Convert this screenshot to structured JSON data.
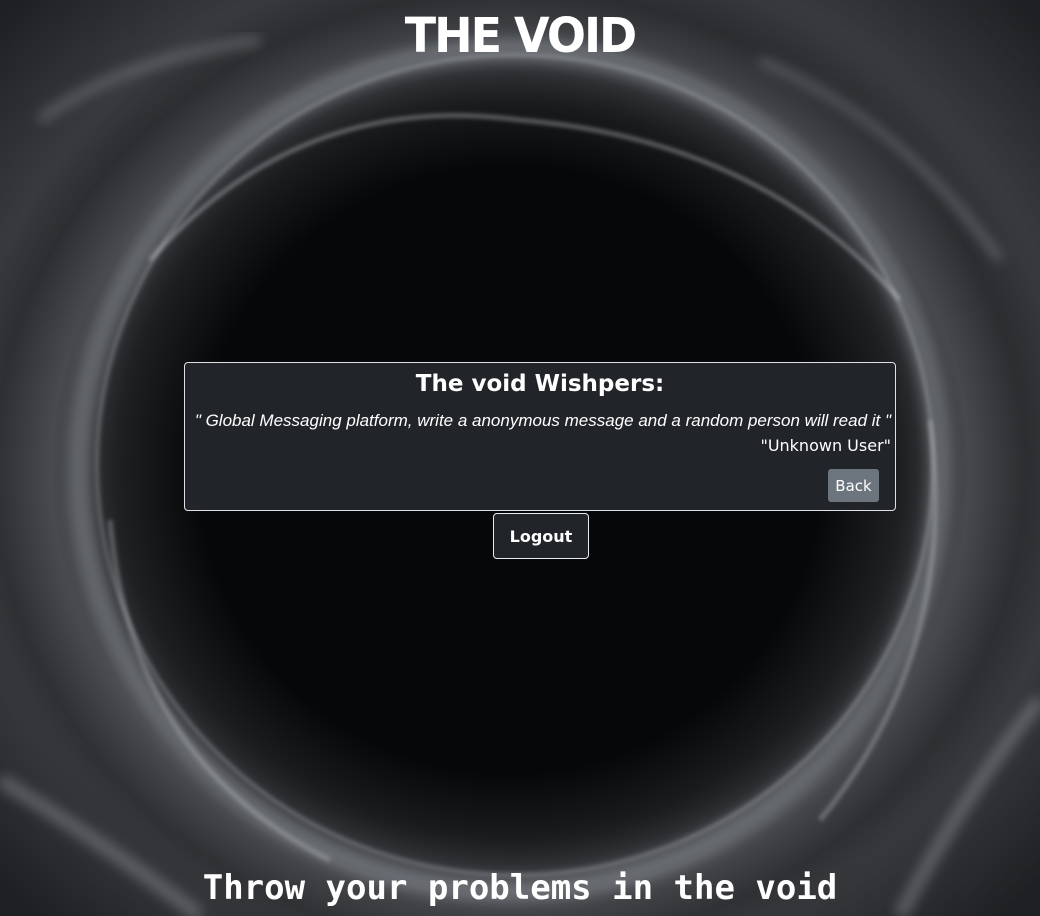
{
  "header": {
    "title": "THE VOID"
  },
  "card": {
    "heading": "The void Wishpers:",
    "message": "\" Global Messaging platform, write a anonymous message and a random person will read it \"",
    "author": "\"Unknown User\"",
    "back_label": "Back"
  },
  "actions": {
    "logout_label": "Logout"
  },
  "footer": {
    "tagline": "Throw your problems in the void"
  },
  "colors": {
    "card_bg": "#212529",
    "back_button": "#6c757d",
    "background": "#060708"
  }
}
